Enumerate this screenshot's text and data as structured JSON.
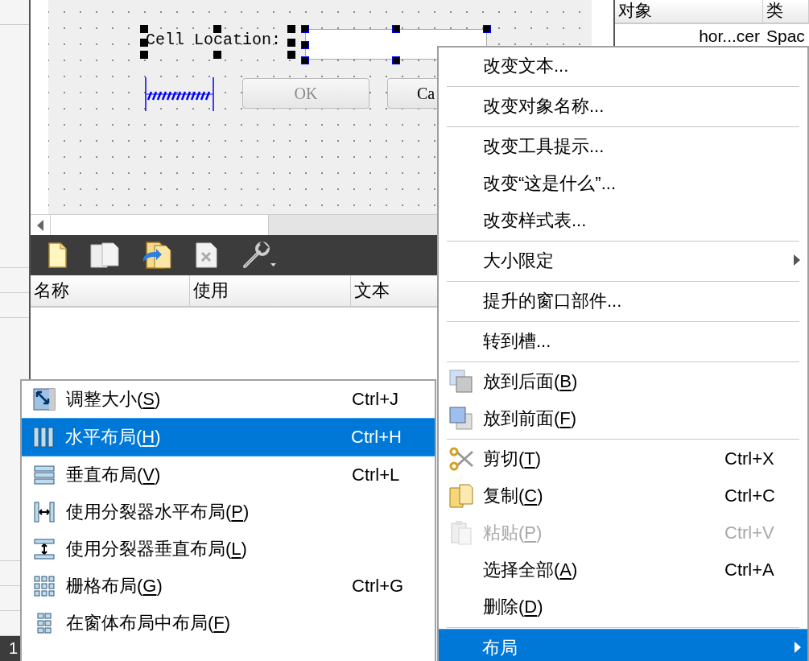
{
  "form": {
    "label": "Cell Location:",
    "ok_button": "OK",
    "cancel_button": "Ca"
  },
  "object_inspector": {
    "columns": [
      "对象",
      "类"
    ],
    "rows": [
      [
        "hor...cer",
        "Spac"
      ]
    ]
  },
  "resource_table": {
    "columns": [
      "名称",
      "使用",
      "文本"
    ]
  },
  "status_text": "1",
  "context_menu": {
    "items": [
      {
        "kind": "item",
        "label": "改变文本...",
        "submenu": false,
        "selected": false,
        "disabled": false
      },
      {
        "kind": "separator"
      },
      {
        "kind": "item",
        "label": "改变对象名称...",
        "submenu": false,
        "selected": false,
        "disabled": false
      },
      {
        "kind": "separator"
      },
      {
        "kind": "item",
        "label": "改变工具提示...",
        "submenu": false,
        "selected": false,
        "disabled": false
      },
      {
        "kind": "item",
        "label": "改变“这是什么”...",
        "submenu": false,
        "selected": false,
        "disabled": false
      },
      {
        "kind": "item",
        "label": "改变样式表...",
        "submenu": false,
        "selected": false,
        "disabled": false
      },
      {
        "kind": "separator"
      },
      {
        "kind": "item",
        "label": "大小限定",
        "submenu": true,
        "selected": false,
        "disabled": false
      },
      {
        "kind": "separator"
      },
      {
        "kind": "item",
        "label": "提升的窗口部件...",
        "submenu": false,
        "selected": false,
        "disabled": false
      },
      {
        "kind": "separator"
      },
      {
        "kind": "item",
        "label": "转到槽...",
        "submenu": false,
        "selected": false,
        "disabled": false
      },
      {
        "kind": "separator"
      },
      {
        "kind": "item",
        "label": "放到后面(",
        "mnemonic": "B",
        "label_end": ")",
        "submenu": false,
        "selected": false,
        "disabled": false
      },
      {
        "kind": "item",
        "label": "放到前面(",
        "mnemonic": "F",
        "label_end": ")",
        "submenu": false,
        "selected": false,
        "disabled": false
      },
      {
        "kind": "separator"
      },
      {
        "kind": "item",
        "label": "剪切(",
        "mnemonic": "T",
        "label_end": ")",
        "shortcut": "Ctrl+X",
        "submenu": false,
        "selected": false,
        "disabled": false
      },
      {
        "kind": "item",
        "label": "复制(",
        "mnemonic": "C",
        "label_end": ")",
        "shortcut": "Ctrl+C",
        "submenu": false,
        "selected": false,
        "disabled": false
      },
      {
        "kind": "item",
        "label": "粘贴(",
        "mnemonic": "P",
        "label_end": ")",
        "shortcut": "Ctrl+V",
        "submenu": false,
        "selected": false,
        "disabled": true
      },
      {
        "kind": "item",
        "label": "选择全部(",
        "mnemonic": "A",
        "label_end": ")",
        "shortcut": "Ctrl+A",
        "submenu": false,
        "selected": false,
        "disabled": false
      },
      {
        "kind": "item",
        "label": "删除(",
        "mnemonic": "D",
        "label_end": ")",
        "submenu": false,
        "selected": false,
        "disabled": false
      },
      {
        "kind": "separator"
      },
      {
        "kind": "item",
        "label": "布局",
        "submenu": true,
        "selected": true,
        "disabled": false
      }
    ]
  },
  "layout_submenu": {
    "items": [
      {
        "kind": "item",
        "label": "调整大小(",
        "mnemonic": "S",
        "label_end": ")",
        "shortcut": "Ctrl+J",
        "submenu": false,
        "selected": false,
        "disabled": false
      },
      {
        "kind": "item",
        "label": "水平布局(",
        "mnemonic": "H",
        "label_end": ")",
        "shortcut": "Ctrl+H",
        "submenu": false,
        "selected": true,
        "disabled": false
      },
      {
        "kind": "item",
        "label": "垂直布局(",
        "mnemonic": "V",
        "label_end": ")",
        "shortcut": "Ctrl+L",
        "submenu": false,
        "selected": false,
        "disabled": false
      },
      {
        "kind": "item",
        "label": "使用分裂器水平布局(",
        "mnemonic": "P",
        "label_end": ")",
        "submenu": false,
        "selected": false,
        "disabled": false
      },
      {
        "kind": "item",
        "label": "使用分裂器垂直布局(",
        "mnemonic": "L",
        "label_end": ")",
        "submenu": false,
        "selected": false,
        "disabled": false
      },
      {
        "kind": "item",
        "label": "栅格布局(",
        "mnemonic": "G",
        "label_end": ")",
        "shortcut": "Ctrl+G",
        "submenu": false,
        "selected": false,
        "disabled": false
      },
      {
        "kind": "item",
        "label": "在窗体布局中布局(",
        "mnemonic": "F",
        "label_end": ")",
        "submenu": false,
        "selected": false,
        "disabled": false
      }
    ]
  }
}
